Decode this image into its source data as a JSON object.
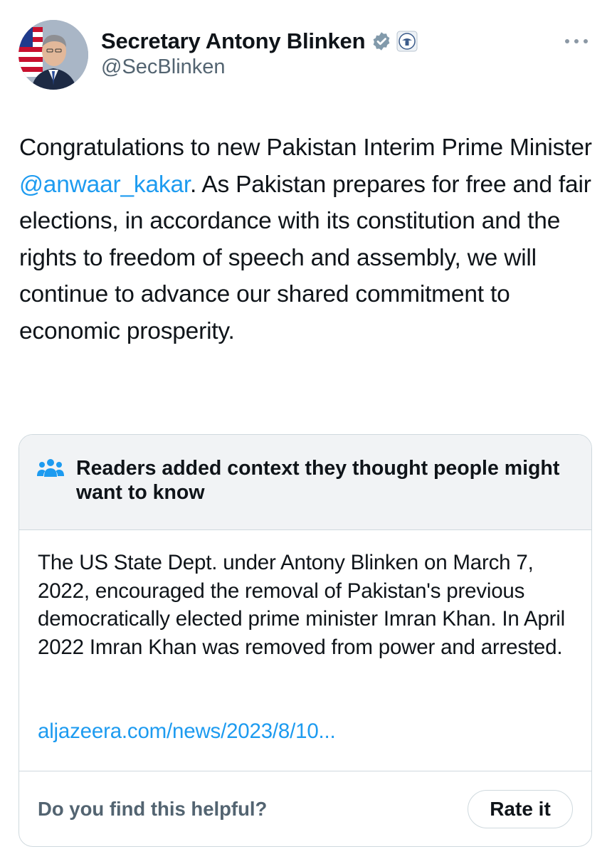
{
  "author": {
    "display_name": "Secretary Antony Blinken",
    "handle": "@SecBlinken",
    "avatar_icon": "profile-photo",
    "verified_icon": "verified-gray-badge-icon",
    "affiliation_icon": "state-department-seal-icon"
  },
  "more_icon": "more-horizontal-icon",
  "tweet": {
    "text_before": "Congratulations to new Pakistan Interim Prime Minister ",
    "mention": "@anwaar_kakar",
    "text_after": ". As Pakistan prepares for free and fair elections, in accordance with its constitution and the rights to freedom of speech and assembly, we will continue to advance our shared commitment to economic prosperity."
  },
  "community_note": {
    "icon": "people-group-icon",
    "title": "Readers added context they thought people might want to know",
    "body": "The US State Dept. under Antony Blinken on March 7, 2022, encouraged the removal of Pakistan's previous democratically elected prime minister Imran Khan. In April 2022 Imran Khan was removed from power and arrested.",
    "link": "aljazeera.com/news/2023/8/10...",
    "helpful_question": "Do you find this helpful?",
    "rate_button": "Rate it"
  },
  "colors": {
    "text": "#0f1419",
    "secondary": "#536471",
    "link": "#1d9bf0",
    "border": "#cfd9de",
    "note_header_bg": "#f1f3f5"
  }
}
